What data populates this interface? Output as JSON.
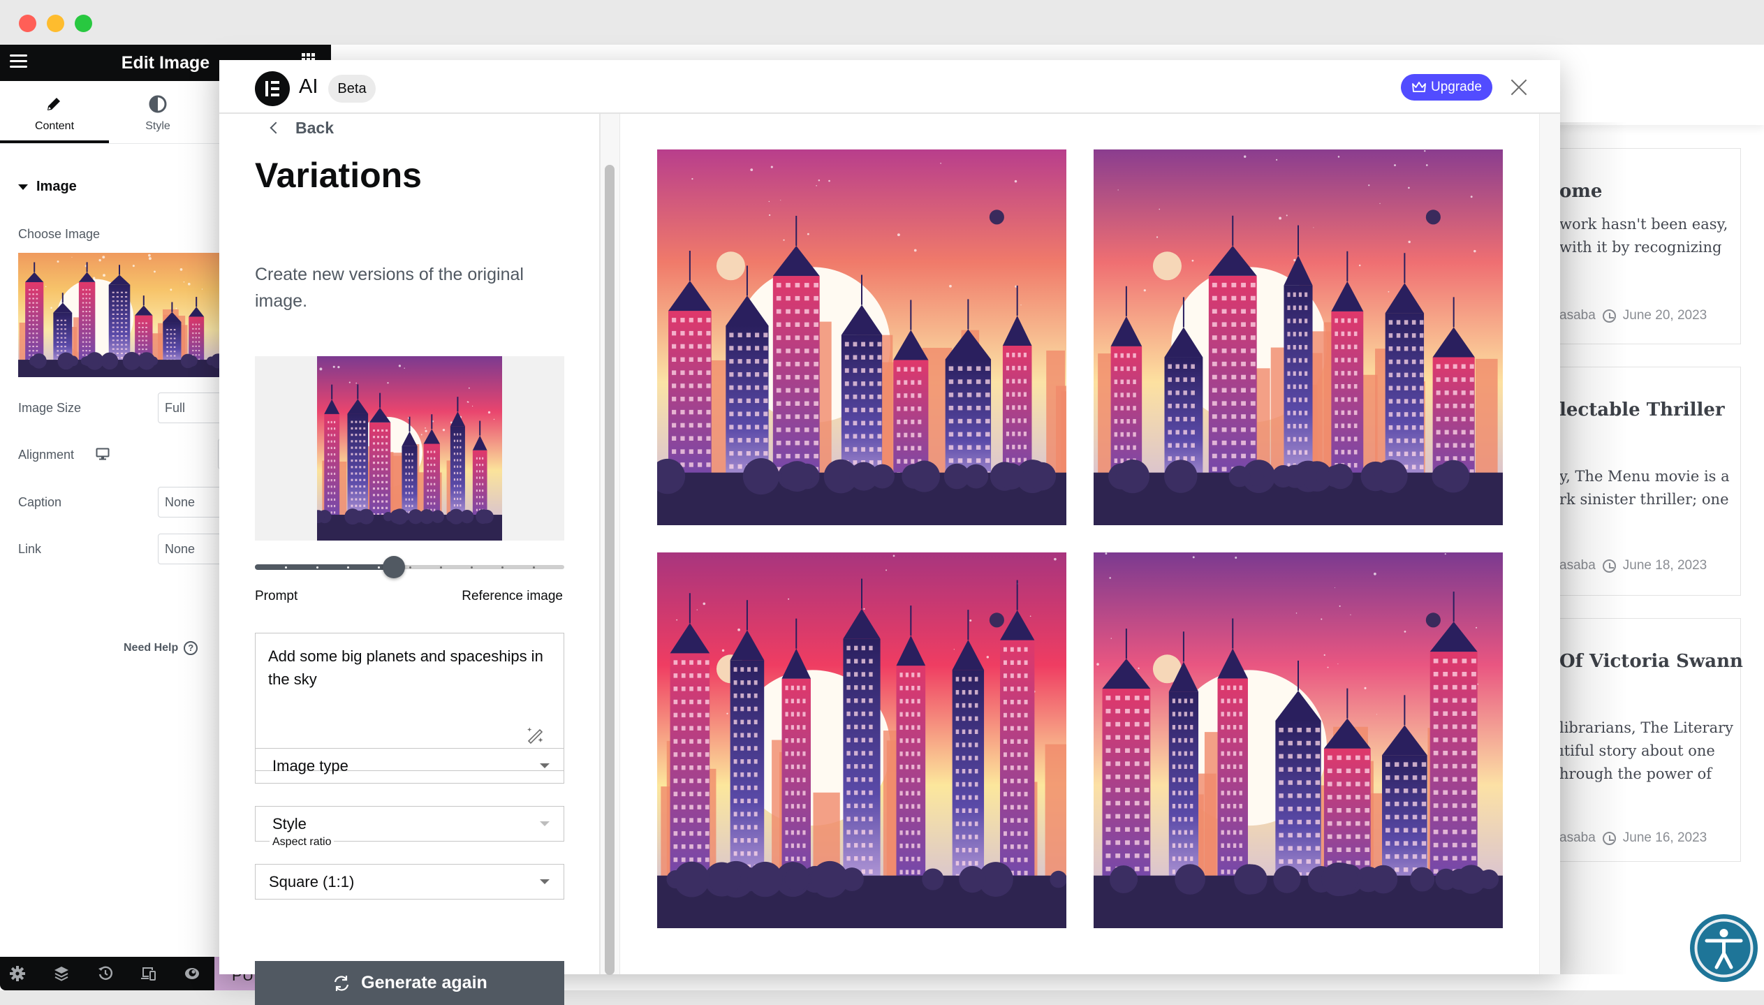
{
  "window": {
    "traffic_lights": [
      {
        "name": "close",
        "color": "#ff5f57"
      },
      {
        "name": "minimize",
        "color": "#febc2e"
      },
      {
        "name": "zoom",
        "color": "#28c840"
      }
    ]
  },
  "editor_panel": {
    "title": "Edit Image",
    "tabs": [
      {
        "label": "Content",
        "icon": "pencil-icon",
        "active": true
      },
      {
        "label": "Style",
        "icon": "half-circle-icon",
        "active": false
      }
    ],
    "section_title": "Image",
    "choose_image_label": "Choose Image",
    "controls": [
      {
        "label": "Image Size",
        "value": "Full"
      },
      {
        "label": "Alignment",
        "value": "",
        "icon": "desktop-icon"
      },
      {
        "label": "Caption",
        "value": "None"
      },
      {
        "label": "Link",
        "value": "None"
      }
    ],
    "need_help": "Need Help",
    "footer_icons": [
      "gear-icon",
      "layers-icon",
      "history-icon",
      "responsive-icon",
      "eye-icon"
    ],
    "publish_label": "PUBLISH"
  },
  "modal": {
    "brand": "AI",
    "badge": "Beta",
    "upgrade_label": "Upgrade",
    "back_label": "Back",
    "title": "Variations",
    "description": "Create new versions of the original image.",
    "slider": {
      "left_label": "Prompt",
      "right_label": "Reference image",
      "steps": 10,
      "value": 0.45
    },
    "prompt_value": "Add some big planets and spaceships in the sky",
    "image_type": {
      "placeholder": "Image type"
    },
    "style": {
      "placeholder": "Style"
    },
    "aspect_ratio": {
      "label": "Aspect ratio",
      "value": "Square (1:1)"
    },
    "generate_label": "Generate again",
    "variations": [
      {
        "name": "variation-1",
        "sky_top": "#b83e8c",
        "sky_mid": "#f07a6a",
        "sky_low": "#fbe3a6"
      },
      {
        "name": "variation-2",
        "sky_top": "#8a3d8f",
        "sky_mid": "#ef6f72",
        "sky_low": "#fde1a0"
      },
      {
        "name": "variation-3",
        "sky_top": "#a8357e",
        "sky_mid": "#ef3d62",
        "sky_low": "#fce79c"
      },
      {
        "name": "variation-4",
        "sky_top": "#7b3a90",
        "sky_mid": "#e95681",
        "sky_low": "#fce1a5"
      }
    ]
  },
  "site": {
    "posts": [
      {
        "title": "ome",
        "lines": [
          "work hasn't been easy,",
          "with it by recognizing"
        ],
        "author": "asaba",
        "date": "June 20, 2023"
      },
      {
        "title": "lectable Thriller",
        "lines": [
          "y, The Menu movie is a",
          "rk sinister thriller; one"
        ],
        "author": "asaba",
        "date": "June 18, 2023"
      },
      {
        "title": "Of Victoria Swann",
        "lines": [
          "librarians, The Literary",
          "ıtiful story about one",
          "hrough the power of"
        ],
        "author": "asaba",
        "date": "June 16, 2023"
      }
    ]
  },
  "colors": {
    "upgrade": "#524cff",
    "primary_dark": "#515962",
    "panel_black": "#0c0d0e",
    "accessibility": "#1e7598"
  }
}
